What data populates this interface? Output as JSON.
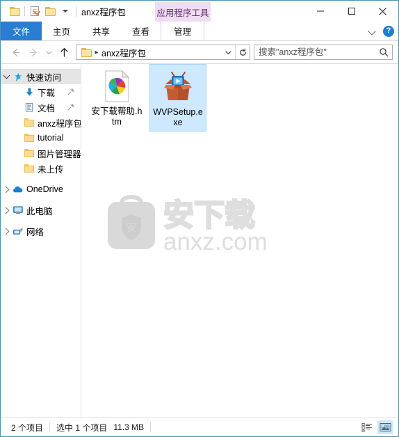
{
  "window": {
    "title": "anxz程序包",
    "contextual_tab_group": "应用程序工具",
    "quick_access_toolbar": [
      {
        "name": "folder-icon",
        "label": "文件夹"
      },
      {
        "name": "properties-icon",
        "label": "属性"
      },
      {
        "name": "new-folder-icon",
        "label": "新建文件夹"
      },
      {
        "name": "customize-caret",
        "label": "自定义快速访问工具栏"
      }
    ],
    "controls": {
      "minimize": "最小化",
      "maximize": "最大化",
      "close": "关闭"
    }
  },
  "ribbon": {
    "tabs": [
      {
        "label": "文件",
        "selected": true,
        "contextual": false
      },
      {
        "label": "主页",
        "selected": false,
        "contextual": false
      },
      {
        "label": "共享",
        "selected": false,
        "contextual": false
      },
      {
        "label": "查看",
        "selected": false,
        "contextual": false
      },
      {
        "label": "管理",
        "selected": false,
        "contextual": true
      }
    ],
    "collapse_label": "展开功能区",
    "help_label": "?",
    "accent_color": "#2b7cd3",
    "contextual_color": "#eedcf0"
  },
  "addressbar": {
    "back_label": "后退",
    "forward_label": "前进",
    "recent_label": "最近浏览的位置",
    "up_label": "上移一级",
    "path_segments": [
      "anxz程序包"
    ],
    "dropdown_label": "以前的位置",
    "refresh_label": "刷新"
  },
  "search": {
    "placeholder": "搜索\"anxz程序包\"",
    "value": "",
    "icon": "search-icon"
  },
  "sidebar": {
    "items": [
      {
        "label": "快速访问",
        "icon": "star-pin-icon",
        "expander": "down",
        "selected": true,
        "indent": 0,
        "pinned": false
      },
      {
        "label": "下载",
        "icon": "download-arrow-icon",
        "expander": "none",
        "selected": false,
        "indent": 1,
        "pinned": true
      },
      {
        "label": "文档",
        "icon": "documents-icon",
        "expander": "none",
        "selected": false,
        "indent": 1,
        "pinned": true
      },
      {
        "label": "anxz程序包",
        "icon": "folder-icon",
        "expander": "none",
        "selected": false,
        "indent": 1,
        "pinned": false
      },
      {
        "label": "tutorial",
        "icon": "folder-icon",
        "expander": "none",
        "selected": false,
        "indent": 1,
        "pinned": false
      },
      {
        "label": "图片管理器",
        "icon": "folder-icon",
        "expander": "none",
        "selected": false,
        "indent": 1,
        "pinned": false
      },
      {
        "label": "未上传",
        "icon": "folder-icon",
        "expander": "none",
        "selected": false,
        "indent": 1,
        "pinned": false
      },
      {
        "label": "OneDrive",
        "icon": "onedrive-cloud-icon",
        "expander": "right",
        "selected": false,
        "indent": 0,
        "pinned": false
      },
      {
        "label": "此电脑",
        "icon": "this-pc-monitor-icon",
        "expander": "right",
        "selected": false,
        "indent": 0,
        "pinned": false
      },
      {
        "label": "网络",
        "icon": "network-icon",
        "expander": "right",
        "selected": false,
        "indent": 0,
        "pinned": false
      }
    ]
  },
  "files": [
    {
      "name": "安下载帮助.htm",
      "icon": "html-document-pinwheel-icon",
      "selected": false
    },
    {
      "name": "WVPSetup.exe",
      "icon": "setup-package-box-play-icon",
      "selected": true
    }
  ],
  "watermark": {
    "text_cn": "安下载",
    "text_url": "anxz.com",
    "badge_char": "安",
    "color": "#d9d9d9"
  },
  "statusbar": {
    "item_count": "2 个项目",
    "selection": "选中 1 个项目",
    "size": "11.3 MB",
    "views": [
      {
        "name": "details-view-button",
        "label": "详细信息",
        "active": false
      },
      {
        "name": "large-icons-view-button",
        "label": "大图标",
        "active": true
      }
    ]
  }
}
